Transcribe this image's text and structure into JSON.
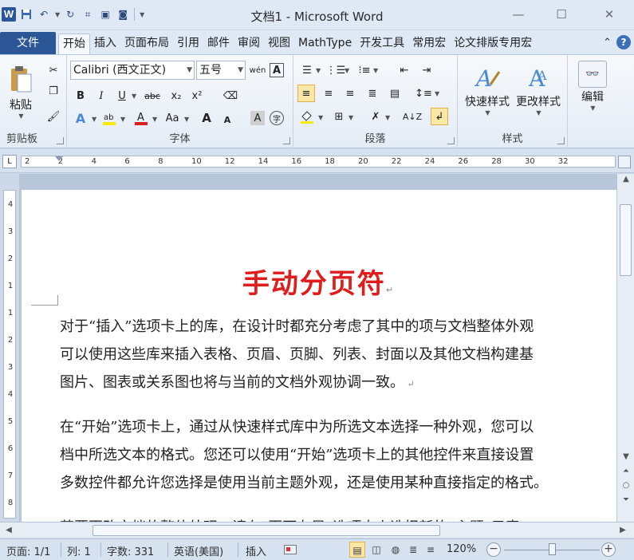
{
  "window": {
    "title": "文档1 - Microsoft Word",
    "app_icon": "W",
    "minimize": "—",
    "maximize": "☐",
    "close": "✕"
  },
  "tabs": {
    "file": "文件",
    "items": [
      "开始",
      "插入",
      "页面布局",
      "引用",
      "邮件",
      "审阅",
      "视图",
      "MathType",
      "开发工具",
      "常用宏",
      "论文排版专用宏"
    ],
    "active_index": 0,
    "help": "?"
  },
  "ribbon": {
    "clipboard": {
      "label": "剪贴板",
      "paste": "粘贴"
    },
    "font": {
      "label": "字体",
      "font_name": "Calibri (西文正文)",
      "font_size": "五号",
      "bold": "B",
      "italic": "I",
      "underline": "U",
      "strike": "abc",
      "subscript": "x₂",
      "superscript": "x²",
      "grow": "A",
      "shrink": "A",
      "change_case": "Aa",
      "char_shading": "A",
      "enclose": "字",
      "phonetic": "wén",
      "border": "A"
    },
    "paragraph": {
      "label": "段落"
    },
    "styles": {
      "label": "样式",
      "quick_styles": "快速样式",
      "change_styles": "更改样式"
    },
    "editing": {
      "label": "编辑",
      "edit": "编辑"
    }
  },
  "ruler": {
    "h_ticks": [
      "2",
      "2",
      "4",
      "6",
      "8",
      "10",
      "12",
      "14",
      "16",
      "18",
      "20",
      "22",
      "24",
      "26",
      "28",
      "30",
      "32"
    ],
    "v_ticks": [
      "4",
      "3",
      "2",
      "1",
      "1",
      "2",
      "3",
      "4",
      "5",
      "6",
      "7",
      "8"
    ]
  },
  "document": {
    "title": "手动分页符",
    "paragraphs": [
      [
        "对于“插入”选项卡上的库，在设计时都充分考虑了其中的项与文档整体外观",
        "可以使用这些库来插入表格、页眉、页脚、列表、封面以及其他文档构建基",
        "图片、图表或关系图也将与当前的文档外观协调一致。"
      ],
      [
        "在“开始”选项卡上，通过从快速样式库中为所选文本选择一种外观，您可以",
        "档中所选文本的格式。您还可以使用“开始”选项卡上的其他控件来直接设置",
        "多数控件都允许您选择是使用当前主题外观，还是使用某种直接指定的格式。"
      ],
      [
        "若要更改文档的整体外观，请在“页面布局”选项卡上选择新的“主题”元素"
      ]
    ]
  },
  "statusbar": {
    "page": "页面: 1/1",
    "column": "列: 1",
    "word_count": "字数: 331",
    "language": "英语(美国)",
    "insert_mode": "插入",
    "zoom": "120%",
    "zoom_level_percent": 120
  },
  "colors": {
    "title_red": "#e01c1c",
    "file_tab": "#2b5797",
    "ribbon_bg": "#eef3f9"
  }
}
